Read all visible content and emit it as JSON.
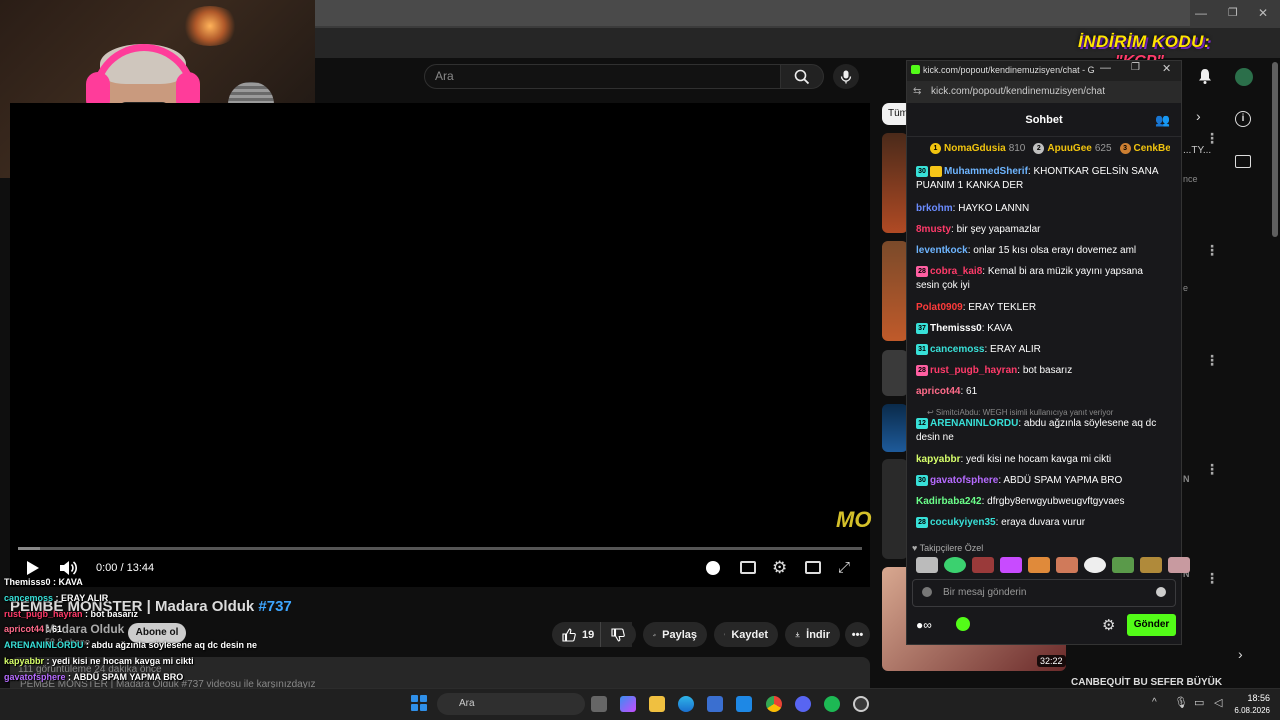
{
  "youtube": {
    "search_placeholder": "Ara",
    "time_display": "0:00 / 13:44",
    "progress_fraction": 0.026,
    "video_title": "PEMBE MONSTER | Madara Olduk",
    "video_title_hash": "#737",
    "channel_name": "Madara Olduk",
    "channel_subs": "58,8 abone",
    "subscribe_label": "Abone ol",
    "likes": "19",
    "share_label": "Paylaş",
    "save_label": "Kaydet",
    "download_label": "İndir",
    "desc_line1": "111 görüntüleme  24 dakika önce",
    "desc_line2": "PEMBE MONSTER | Madara Olduk #737 videosu ile karşınızdayız",
    "tag_chip": "Tüm",
    "sidebar_title_1": "...TY...",
    "sidebar_sub_1": "nce",
    "sidebar_sub_2": "e",
    "sidebar_sub_3": "N",
    "sidebar_sub_4": "N",
    "sidebar_bottom_title": "CANBEQUİT BU SEFER BÜYÜK",
    "duration_badge": "32:22",
    "logo_text": "MO"
  },
  "promo": {
    "line1": "İNDİRİM KODU:",
    "line2": "\"KCP\""
  },
  "kick": {
    "window_title": "kick.com/popout/kendinemuzisyen/chat - Go...",
    "url": "kick.com/popout/kendinemuzisyen/chat",
    "chat_title": "Sohbet",
    "leaderboard": [
      {
        "rank": "1",
        "name": "NomaGdusia",
        "score": "810",
        "color": "#f1c40f"
      },
      {
        "rank": "2",
        "name": "ApuuGee",
        "score": "625",
        "color": "#c0c0c0"
      },
      {
        "rank": "3",
        "name": "CenkBe",
        "score": "",
        "color": "#cd7f32"
      }
    ],
    "messages": [
      {
        "badge": "30",
        "name": "MuhammedSherif",
        "text": "KHONTKAR GELSİN SANA PUANIM 1 KANKA DER",
        "color": "#6eb5ff"
      },
      {
        "badge": "",
        "name": "brkohm",
        "text": "HAYKO LANNN",
        "color": "#6b8cff"
      },
      {
        "badge": "",
        "name": "8musty",
        "text": "bir şey yapamazlar",
        "color": "#ff3b6a"
      },
      {
        "badge": "",
        "name": "leventkock",
        "text": "onlar 15 kısı olsa erayı dovemez aml",
        "color": "#6eb5ff"
      },
      {
        "badge": "28",
        "name": "cobra_kai8",
        "text": "Kemal bi ara müzik yayını yapsana sesin çok iyi",
        "color": "#ff3b6a"
      },
      {
        "badge": "",
        "name": "Polat0909",
        "text": "ERAY TEKLER",
        "color": "#ff3b3b"
      },
      {
        "badge": "37",
        "name": "Themisss0",
        "text": "KAVA",
        "color": "#ffffff"
      },
      {
        "badge": "31",
        "name": "cancemoss",
        "text": "ERAY ALIR",
        "color": "#38e0d8"
      },
      {
        "badge": "28",
        "name": "rust_pugb_hayran",
        "text": "bot basarız",
        "color": "#ff3b6a"
      },
      {
        "badge": "",
        "name": "apricot44",
        "text": "61",
        "color": "#ff6b8a"
      },
      {
        "badge": "12",
        "name": "ARENANINLORDU",
        "text": "abdu ağzınla söylesene aq dc desin ne",
        "color": "#38e0d8"
      },
      {
        "badge": "",
        "name": "kapyabbr",
        "text": "yedi kisi ne hocam kavga mi cikti",
        "color": "#d7ff6b"
      },
      {
        "badge": "30",
        "name": "gavatofsphere",
        "text": "ABDÜ SPAM YAPMA BRO",
        "color": "#b66bff"
      },
      {
        "badge": "",
        "name": "Kadirbaba242",
        "text": "dfrgby8erwgyubweugvftgyvaes",
        "color": "#6bff8a"
      },
      {
        "badge": "28",
        "name": "cocukyiyen35",
        "text": "eraya duvara vurur",
        "color": "#38e0d8"
      }
    ],
    "reply_note": "↩ SimitciAbdu: WEGH isimli kullanıcıya yanıt veriyor",
    "followers_only": "♥ Takipçilere Özel",
    "input_placeholder": "Bir mesaj gönderin",
    "send_label": "Gönder"
  },
  "overlay_chat": [
    {
      "name": "Themisss0",
      "text": "KAVA",
      "color": "#ffffff"
    },
    {
      "name": "cancemoss",
      "text": "ERAY ALIR",
      "color": "#38e0d8"
    },
    {
      "name": "rust_pugb_hayran",
      "text": "bot basarız",
      "color": "#ff3b6a"
    },
    {
      "name": "apricot44",
      "text": "61",
      "color": "#ff6b8a"
    },
    {
      "name": "ARENANINLORDU",
      "text": "abdu ağzınla söylesene aq dc desin ne",
      "color": "#38e0d8"
    },
    {
      "name": "kapyabbr",
      "text": "yedi kisi ne hocam kavga mi cikti",
      "color": "#d7ff6b"
    },
    {
      "name": "gavatofsphere",
      "text": "ABDÜ SPAM YAPMA BRO",
      "color": "#b66bff"
    },
    {
      "name": "Kadirbaba242",
      "text": "dfrgby8erwgyubweugvftgyvaes",
      "color": "#6bff8a"
    },
    {
      "name": "cocukyiyen35",
      "text": "eraya duvara vurur",
      "color": "#38e0d8"
    }
  ],
  "taskbar": {
    "search_placeholder": "Ara",
    "time": "18:56",
    "date": "6.08.2026"
  }
}
